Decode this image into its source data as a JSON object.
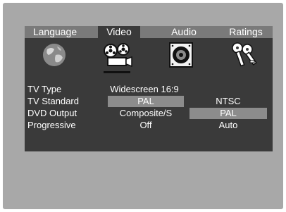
{
  "tabs": [
    {
      "label": "Language",
      "active": false
    },
    {
      "label": "Video",
      "active": true
    },
    {
      "label": "Audio",
      "active": false
    },
    {
      "label": "Ratings",
      "active": false
    }
  ],
  "icons": [
    "globe-icon",
    "film-projector-icon",
    "speaker-icon",
    "keys-icon"
  ],
  "settings": {
    "tv_type": {
      "label": "TV Type",
      "value": "Widescreen 16:9"
    },
    "tv_standard": {
      "label": "TV Standard",
      "options": [
        "PAL",
        "NTSC"
      ],
      "selected": "PAL"
    },
    "dvd_output": {
      "label": "DVD Output",
      "options": [
        "Composite/S",
        "PAL"
      ],
      "selected": "PAL"
    },
    "progressive": {
      "label": "Progressive",
      "options": [
        "Off",
        "Auto"
      ],
      "selected": "Off"
    }
  },
  "colors": {
    "panel": "#3a3a3a",
    "tab_bar": "#7a7a7a",
    "highlight": "#8c8c8c",
    "text": "#ffffff"
  }
}
